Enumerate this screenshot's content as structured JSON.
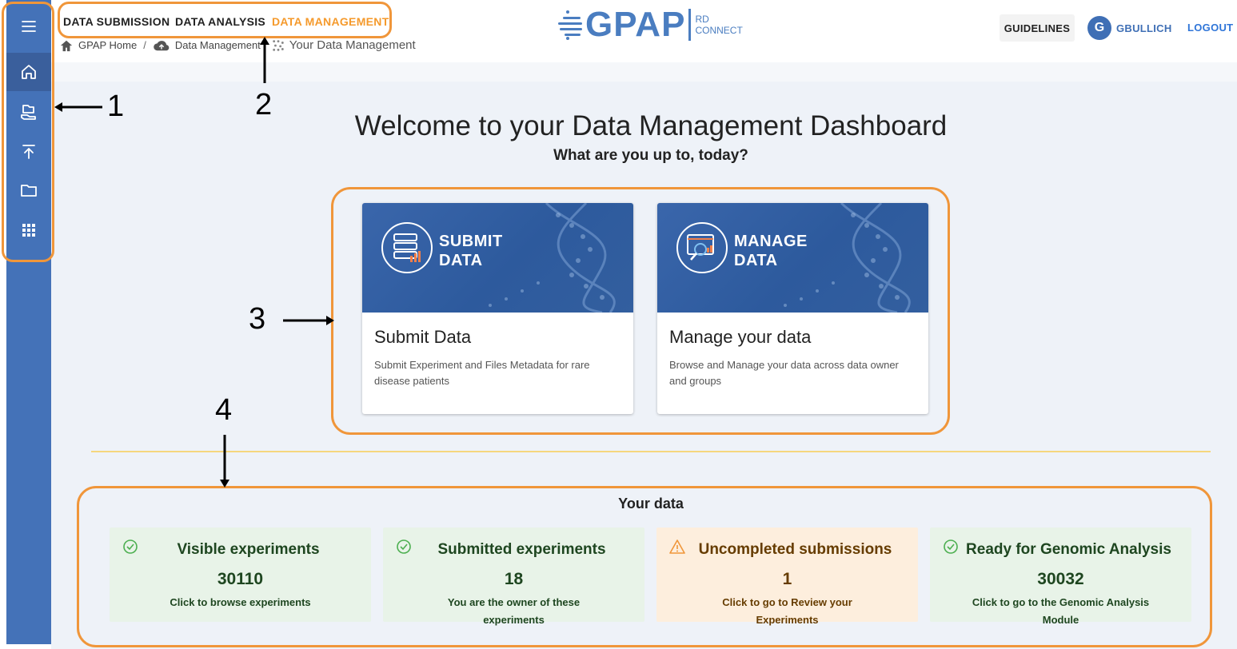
{
  "sidebar": {
    "items": [
      {
        "icon": "menu-icon"
      },
      {
        "icon": "home-icon",
        "active": true
      },
      {
        "icon": "data-submission-icon"
      },
      {
        "icon": "upload-icon"
      },
      {
        "icon": "folder-icon"
      },
      {
        "icon": "apps-grid-icon"
      }
    ]
  },
  "header": {
    "nav": [
      "DATA SUBMISSION",
      "DATA ANALYSIS",
      "DATA MANAGEMENT"
    ],
    "logo_main": "GPAP",
    "logo_sub_line1": "RD",
    "logo_sub_line2": "CONNECT",
    "breadcrumb": [
      "GPAP Home",
      "Data Management",
      "Your Data Management"
    ],
    "guidelines": "GUIDELINES",
    "user_initial": "G",
    "user_name": "GBULLICH",
    "logout": "LOGOUT"
  },
  "main": {
    "welcome": "Welcome to your Data Management Dashboard",
    "subtitle": "What are you up to, today?",
    "cards": [
      {
        "banner_line1": "SUBMIT",
        "banner_line2": "DATA",
        "title": "Submit Data",
        "description": "Submit Experiment and Files Metadata for rare disease patients"
      },
      {
        "banner_line1": "MANAGE",
        "banner_line2": "DATA",
        "title": "Manage your data",
        "description": "Browse and Manage your data across data owner and groups"
      }
    ],
    "your_data_title": "Your data",
    "stats": [
      {
        "title": "Visible experiments",
        "value": "30110",
        "subtitle": "Click to browse experiments",
        "status": "success"
      },
      {
        "title": "Submitted experiments",
        "value": "18",
        "subtitle": "You are the owner of these experiments",
        "status": "success"
      },
      {
        "title": "Uncompleted submissions",
        "value": "1",
        "subtitle": "Click to go to Review your Experiments",
        "status": "warning"
      },
      {
        "title": "Ready for Genomic Analysis",
        "value": "30032",
        "subtitle": "Click to go to the Genomic Analysis Module",
        "status": "success"
      }
    ]
  },
  "annotations": {
    "labels": [
      "1",
      "2",
      "3",
      "4"
    ],
    "color": "#f0963a"
  },
  "colors": {
    "sidebar": "#4472b8",
    "accent": "#f59a2c",
    "brand": "#4a7dc0"
  }
}
